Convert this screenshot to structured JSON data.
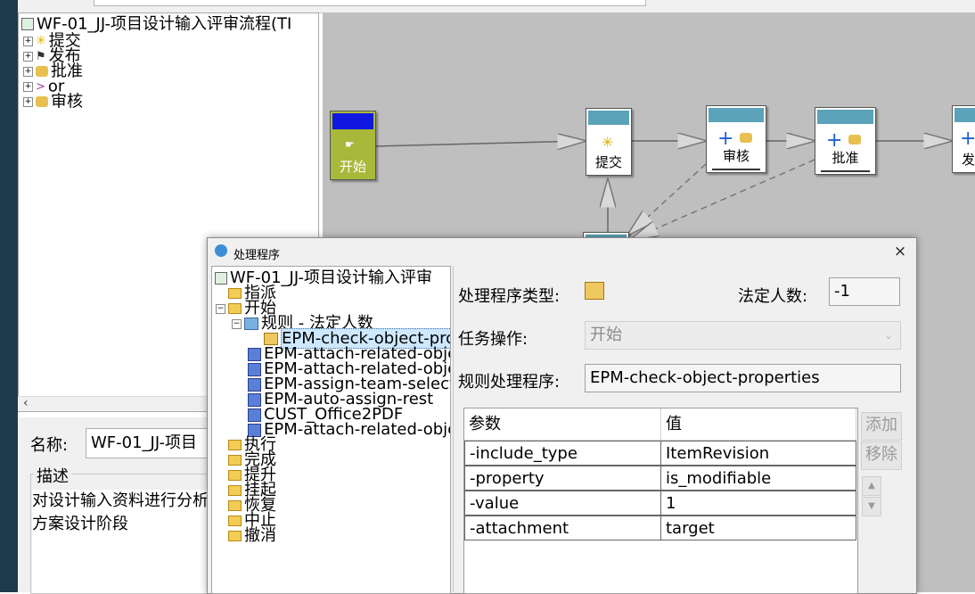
{
  "workflow_tree": {
    "root_label": "WF-01_JJ-项目设计输入评审流程(TI",
    "items": [
      "提交",
      "发布",
      "批准",
      "or",
      "审核"
    ]
  },
  "properties": {
    "name_label": "名称:",
    "name_value": "WF-01_JJ-项目",
    "description_label": "描述",
    "description_text": "对设计输入资料进行分析\n方案设计阶段"
  },
  "canvas": {
    "nodes": [
      {
        "label": "开始",
        "icon": "start-handler-icon"
      },
      {
        "label": "提交",
        "icon": "star-icon"
      },
      {
        "label": "审核",
        "icon": "review-task-icon"
      },
      {
        "label": "批准",
        "icon": "approve-task-icon"
      },
      {
        "label": "发",
        "icon": "task-icon"
      }
    ]
  },
  "dialog": {
    "title": "处理程序",
    "close_glyph": "×",
    "tree": {
      "root": "WF-01_JJ-项目设计输入评审",
      "assign": "指派",
      "start": "开始",
      "rule": "规则 - 法定人数",
      "rule_handler": "EPM-check-object-properties",
      "handlers": [
        "EPM-attach-related-objects",
        "EPM-attach-related-objects",
        "EPM-assign-team-selector",
        "EPM-auto-assign-rest",
        "CUST_Office2PDF",
        "EPM-attach-related-objects"
      ],
      "later_folders": [
        "执行",
        "完成",
        "提升",
        "挂起",
        "恢复",
        "中止",
        "撤消"
      ]
    },
    "handler_type_label": "处理程序类型:",
    "quorum_label": "法定人数:",
    "quorum_value": "-1",
    "task_action_label": "任务操作:",
    "task_action_value": "开始",
    "rule_handler_label": "规则处理程序:",
    "rule_handler_value": "EPM-check-object-properties",
    "table": {
      "headers": [
        "参数",
        "值"
      ],
      "rows": [
        [
          "-include_type",
          "ItemRevision"
        ],
        [
          "-property",
          "is_modifiable"
        ],
        [
          "-value",
          "1"
        ],
        [
          "-attachment",
          "target"
        ]
      ]
    },
    "add_button": "添加",
    "remove_button": "移除",
    "move_up_glyph": "▲",
    "move_down_glyph": "▼"
  }
}
